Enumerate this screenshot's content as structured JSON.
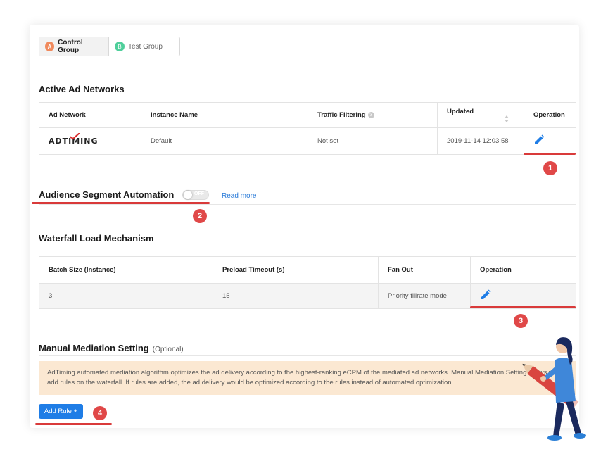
{
  "groups": [
    {
      "badge": "A",
      "label": "Control Group"
    },
    {
      "badge": "B",
      "label": "Test Group"
    }
  ],
  "active_networks": {
    "title": "Active Ad Networks",
    "columns": [
      "Ad Network",
      "Instance Name",
      "Traffic Filtering",
      "Updated",
      "Operation"
    ],
    "rows": [
      {
        "network_logo": "ADTIMING",
        "instance": "Default",
        "traffic": "Not set",
        "updated": "2019-11-14 12:03:58"
      }
    ]
  },
  "audience": {
    "title": "Audience Segment Automation",
    "toggle_text": "OFF",
    "toggle_on": false,
    "read_more": "Read more"
  },
  "waterfall": {
    "title": "Waterfall Load Mechanism",
    "columns": [
      "Batch Size (Instance)",
      "Preload Timeout (s)",
      "Fan Out",
      "Operation"
    ],
    "rows": [
      {
        "batch": "3",
        "timeout": "15",
        "fanout": "Priority fillrate mode"
      }
    ]
  },
  "manual": {
    "title": "Manual Mediation Setting",
    "optional": "(Optional)",
    "notice": "AdTiming automated mediation algorithm optimizes the ad delivery according to the highest-ranking eCPM of the mediated ad networks. Manual Mediation Setting allows you to add rules on the waterfall. If rules are added, the ad delivery would be optimized according to the rules instead of automated optimization.",
    "add_rule": "Add Rule +"
  },
  "callouts": [
    "1",
    "2",
    "3",
    "4"
  ],
  "colors": {
    "accent": "#1f7de6",
    "callout": "#e04848",
    "notice_bg": "#fbe8d2",
    "badge_a": "#f08a5d",
    "badge_b": "#4fcf9b"
  },
  "icons": [
    "edit-pencil-icon",
    "info-icon",
    "sort-icon"
  ]
}
